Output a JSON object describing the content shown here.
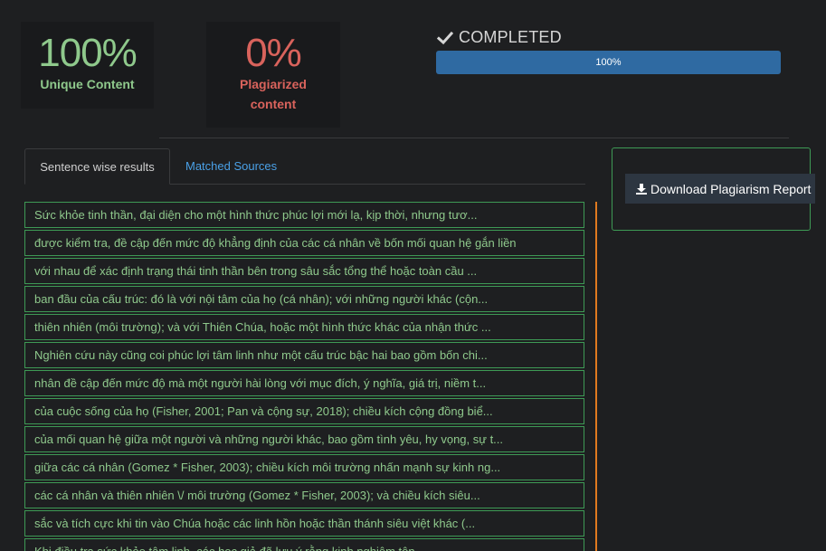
{
  "stats": {
    "unique": {
      "value": "100%",
      "label": "Unique Content"
    },
    "plagiarized": {
      "value": "0%",
      "label_line1": "Plagiarized",
      "label_line2": "content"
    }
  },
  "status": {
    "text": "COMPLETED",
    "icon": "check-icon"
  },
  "progress": {
    "percent": 100,
    "label": "100%"
  },
  "tabs": [
    {
      "label": "Sentence wise results",
      "active": true
    },
    {
      "label": "Matched Sources",
      "active": false
    }
  ],
  "download": {
    "label": "Download Plagiarism Report",
    "icon": "download-icon"
  },
  "sentences": [
    "Sức khỏe tinh thần, đại diện cho một hình thức phúc lợi mới lạ, kịp thời, nhưng tươ...",
    "được kiểm tra, đề cập đến mức độ khẳng định của các cá nhân về bốn mối quan hệ gắn liền",
    "với nhau để xác định trạng thái tinh thần bên trong sâu sắc tổng thể hoặc toàn cầu ...",
    "ban đầu của cấu trúc: đó là với nội tâm của họ (cá nhân); với những người khác (cộn...",
    "thiên nhiên (môi trường); và với Thiên Chúa, hoặc một hình thức khác của nhận thức ...",
    "Nghiên cứu này cũng coi phúc lợi tâm linh như một cấu trúc bậc hai bao gồm bốn chi...",
    "nhân đề cập đến mức độ mà một người hài lòng với mục đích, ý nghĩa, giá trị, niềm t...",
    "của cuộc sống của họ (Fisher, 2001; Pan và cộng sự, 2018); chiều kích cộng đồng biể...",
    "của mối quan hệ giữa một người và những người khác, bao gồm tình yêu, hy vọng, sự t...",
    "giữa các cá nhân (Gomez * Fisher, 2003); chiều kích môi trường nhấn mạnh sự kinh ng...",
    "các cá nhân và thiên nhiên \\/ môi trường (Gomez * Fisher, 2003); và chiều kích siêu...",
    "sắc và tích cực khi tin vào Chúa hoặc các linh hồn hoặc thần thánh siêu việt khác (...",
    "Khi điều tra sức khỏe tâm linh, các học giả đã lưu ý rằng kinh nghiệm tôn..."
  ]
}
